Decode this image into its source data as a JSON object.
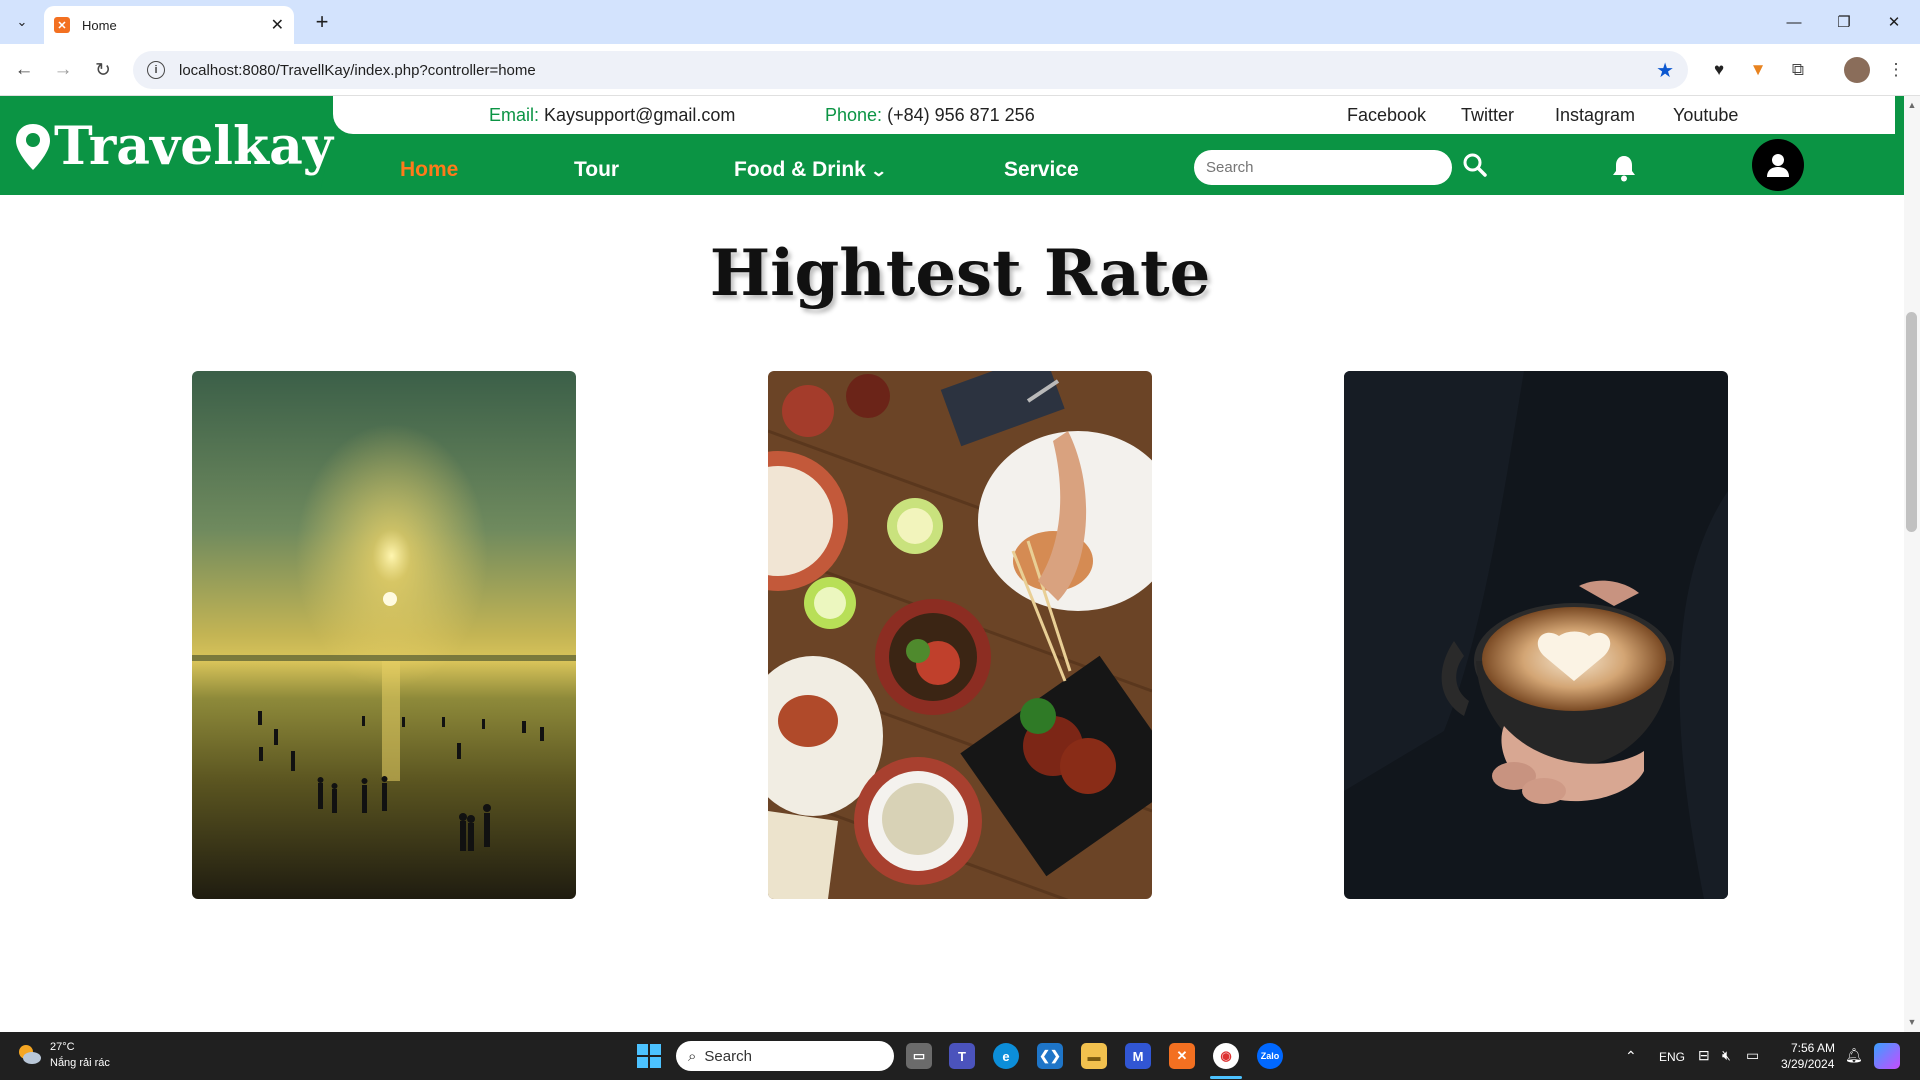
{
  "browser": {
    "tab_title": "Home",
    "url": "localhost:8080/TravellKay/index.php?controller=home"
  },
  "site": {
    "logo": "Travelkay",
    "topbar": {
      "email_label": "Email:",
      "email": "Kaysupport@gmail.com",
      "phone_label": "Phone:",
      "phone": "(+84) 956 871 256",
      "social": [
        "Facebook",
        "Twitter",
        "Instagram",
        "Youtube"
      ]
    },
    "nav": {
      "home": "Home",
      "tour": "Tour",
      "food": "Food & Drink",
      "service": "Service"
    },
    "search_placeholder": "Search",
    "active_color": "#ff7a1a",
    "brand_color": "#0b9444"
  },
  "section": {
    "title": "Hightest Rate",
    "cards": [
      "beach-sunset-photo",
      "food-table-photo",
      "latte-coffee-photo"
    ]
  },
  "taskbar": {
    "weather_temp": "27°C",
    "weather_desc": "Nắng rải rác",
    "search": "Search",
    "lang": "ENG",
    "time": "7:56 AM",
    "date": "3/29/2024"
  }
}
